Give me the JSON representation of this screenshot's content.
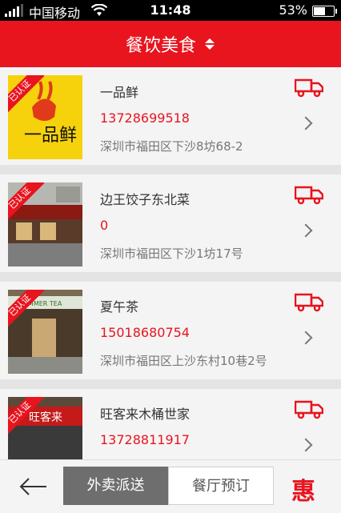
{
  "status_bar": {
    "carrier": "中国移动",
    "time": "11:48",
    "battery": "53%",
    "battery_level": 0.53
  },
  "header": {
    "title": "餐饮美食"
  },
  "restaurants": [
    {
      "name": "一品鲜",
      "phone": "13728699518",
      "address": "深圳市福田区下沙8坊68-2",
      "badge": "已认证",
      "logo_text": "一品鲜"
    },
    {
      "name": "边王饺子东北菜",
      "phone": "0",
      "address": "深圳市福田区下沙1坊17号",
      "badge": "已认证"
    },
    {
      "name": "夏午茶",
      "phone": "15018680754",
      "address": "深圳市福田区上沙东村10巷2号",
      "badge": "已认证",
      "sign_text": "SUMMER TEA"
    },
    {
      "name": "旺客来木桶世家",
      "phone": "13728811917",
      "address": "",
      "badge": "已认证",
      "sign_text": "旺客来"
    }
  ],
  "bottom_bar": {
    "tab_delivery": "外卖派送",
    "tab_reserve": "餐厅预订",
    "hui_label": "惠"
  },
  "colors": {
    "brand_red": "#e8141e",
    "active_tab": "#6e6e6e"
  }
}
